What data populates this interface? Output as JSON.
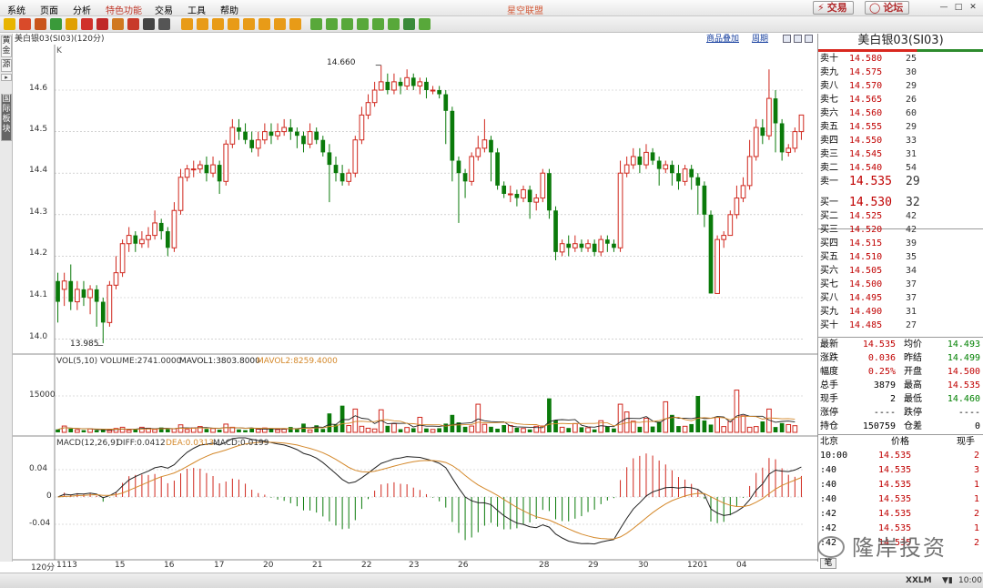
{
  "menu": [
    "系统",
    "页面",
    "分析",
    "特色功能",
    "交易",
    "工具",
    "帮助"
  ],
  "app_title": "星空联盟",
  "top_buttons": {
    "trade": "交易",
    "forum": "论坛"
  },
  "toolbar_icons": [
    "back-icon",
    "home-icon",
    "screen-icon",
    "refresh-icon",
    "zoom-in-icon",
    "zoom-out-icon",
    "pen-icon",
    "cursor-icon",
    "filter-icon",
    "grid-icon",
    "kline-icon",
    "period-1m",
    "period-5m",
    "period-15m",
    "period-30m",
    "period-60m",
    "period-day",
    "period-week",
    "period-month",
    "period-1-icon",
    "period-3-icon",
    "period-15-icon",
    "period-30-icon",
    "period-60-icon",
    "period-120-icon",
    "period-tick-icon",
    "period-min-icon"
  ],
  "side_tabs": [
    "黄金",
    "源",
    "国际板块"
  ],
  "chart": {
    "title": "美白银03(SI03)(120分)",
    "links": [
      "商品叠加",
      "周期"
    ],
    "k_label": "K",
    "annotations": {
      "high": "14.660",
      "low": "13.985"
    },
    "y_ticks": [
      "14.6",
      "14.5",
      "14.4",
      "14.3",
      "14.2",
      "14.1",
      "14.0"
    ],
    "x_ticks": [
      "1113",
      "15",
      "16",
      "17",
      "20",
      "21",
      "22",
      "23",
      "26",
      "28",
      "29",
      "30",
      "1201",
      "04"
    ],
    "period_label": "120分",
    "volume": {
      "label_vol": "VOL(5,10)",
      "label_volume": "VOLUME:2741.0000",
      "label_mavol1": "MAVOL1:3803.8000",
      "label_mavol2": "MAVOL2:8259.4000",
      "y_tick": "15000"
    },
    "macd": {
      "label_macd": "MACD(12,26,9)",
      "label_diff": "DIFF:0.0412",
      "label_dea": "DEA:0.0313",
      "label_value": "MACD:0.0199",
      "y_ticks": [
        "0.04",
        "0",
        "-0.04"
      ]
    }
  },
  "colors": {
    "up": "#d0271d",
    "down": "#0a7a0a",
    "ma1": "#222222",
    "ma2": "#d4882a"
  },
  "chart_data": [
    {
      "type": "candlestick",
      "title": "美白银03(SI03)(120分)",
      "ylim": [
        13.96,
        14.71
      ],
      "y_ticks": [
        14.0,
        14.1,
        14.2,
        14.3,
        14.4,
        14.5,
        14.6
      ],
      "x_ticks": [
        "1113",
        "15",
        "16",
        "17",
        "20",
        "21",
        "22",
        "23",
        "26",
        "28",
        "29",
        "30",
        "1201",
        "04"
      ],
      "high": 14.66,
      "low": 13.985,
      "candles": [
        [
          14.14,
          14.09,
          14.16,
          14.04
        ],
        [
          14.12,
          14.14,
          14.16,
          14.08
        ],
        [
          14.14,
          14.09,
          14.18,
          14.07
        ],
        [
          14.09,
          14.12,
          14.14,
          14.07
        ],
        [
          14.12,
          14.1,
          14.14,
          14.08
        ],
        [
          14.1,
          14.12,
          14.13,
          14.06
        ],
        [
          14.12,
          14.09,
          14.13,
          14.03
        ],
        [
          14.09,
          14.04,
          14.1,
          13.99
        ],
        [
          14.04,
          14.13,
          14.14,
          14.03
        ],
        [
          14.13,
          14.16,
          14.2,
          14.12
        ],
        [
          14.16,
          14.23,
          14.24,
          14.15
        ],
        [
          14.23,
          14.25,
          14.27,
          14.21
        ],
        [
          14.25,
          14.23,
          14.26,
          14.21
        ],
        [
          14.23,
          14.24,
          14.26,
          14.22
        ],
        [
          14.24,
          14.25,
          14.27,
          14.22
        ],
        [
          14.25,
          14.28,
          14.31,
          14.24
        ],
        [
          14.28,
          14.26,
          14.29,
          14.24
        ],
        [
          14.26,
          14.22,
          14.27,
          14.2
        ],
        [
          14.22,
          14.31,
          14.33,
          14.21
        ],
        [
          14.31,
          14.39,
          14.41,
          14.3
        ],
        [
          14.39,
          14.41,
          14.42,
          14.38
        ],
        [
          14.41,
          14.41,
          14.43,
          14.39
        ],
        [
          14.41,
          14.42,
          14.43,
          14.4
        ],
        [
          14.42,
          14.4,
          14.44,
          14.38
        ],
        [
          14.4,
          14.42,
          14.44,
          14.39
        ],
        [
          14.42,
          14.38,
          14.43,
          14.35
        ],
        [
          14.38,
          14.47,
          14.48,
          14.37
        ],
        [
          14.47,
          14.51,
          14.53,
          14.46
        ],
        [
          14.51,
          14.5,
          14.53,
          14.48
        ],
        [
          14.5,
          14.48,
          14.52,
          14.47
        ],
        [
          14.48,
          14.46,
          14.5,
          14.45
        ],
        [
          14.46,
          14.48,
          14.5,
          14.44
        ],
        [
          14.48,
          14.5,
          14.52,
          14.47
        ],
        [
          14.5,
          14.49,
          14.52,
          14.47
        ],
        [
          14.49,
          14.5,
          14.52,
          14.48
        ],
        [
          14.5,
          14.51,
          14.53,
          14.49
        ],
        [
          14.51,
          14.5,
          14.53,
          14.48
        ],
        [
          14.5,
          14.49,
          14.51,
          14.46
        ],
        [
          14.49,
          14.47,
          14.5,
          14.45
        ],
        [
          14.47,
          14.5,
          14.52,
          14.46
        ],
        [
          14.5,
          14.48,
          14.51,
          14.47
        ],
        [
          14.48,
          14.45,
          14.49,
          14.44
        ],
        [
          14.45,
          14.42,
          14.47,
          14.33
        ],
        [
          14.42,
          14.4,
          14.44,
          14.38
        ],
        [
          14.4,
          14.38,
          14.42,
          14.37
        ],
        [
          14.38,
          14.4,
          14.41,
          14.37
        ],
        [
          14.4,
          14.48,
          14.49,
          14.39
        ],
        [
          14.48,
          14.54,
          14.56,
          14.47
        ],
        [
          14.54,
          14.57,
          14.59,
          14.53
        ],
        [
          14.57,
          14.6,
          14.62,
          14.56
        ],
        [
          14.6,
          14.62,
          14.66,
          14.6
        ],
        [
          14.62,
          14.6,
          14.64,
          14.59
        ],
        [
          14.6,
          14.62,
          14.64,
          14.59
        ],
        [
          14.62,
          14.61,
          14.63,
          14.59
        ],
        [
          14.61,
          14.63,
          14.65,
          14.6
        ],
        [
          14.63,
          14.61,
          14.64,
          14.6
        ],
        [
          14.61,
          14.62,
          14.63,
          14.59
        ],
        [
          14.62,
          14.6,
          14.63,
          14.58
        ],
        [
          14.6,
          14.6,
          14.61,
          14.59
        ],
        [
          14.6,
          14.59,
          14.61,
          14.58
        ],
        [
          14.59,
          14.55,
          14.6,
          14.47
        ],
        [
          14.55,
          14.43,
          14.56,
          14.38
        ],
        [
          14.43,
          14.4,
          14.44,
          14.28
        ],
        [
          14.4,
          14.38,
          14.41,
          14.34
        ],
        [
          14.38,
          14.44,
          14.45,
          14.37
        ],
        [
          14.44,
          14.46,
          14.49,
          14.43
        ],
        [
          14.46,
          14.48,
          14.53,
          14.45
        ],
        [
          14.48,
          14.45,
          14.49,
          14.38
        ],
        [
          14.45,
          14.37,
          14.46,
          14.36
        ],
        [
          14.37,
          14.35,
          14.38,
          14.34
        ],
        [
          14.35,
          14.35,
          14.37,
          14.33
        ],
        [
          14.35,
          14.34,
          14.36,
          14.32
        ],
        [
          14.34,
          14.36,
          14.37,
          14.33
        ],
        [
          14.36,
          14.33,
          14.37,
          14.29
        ],
        [
          14.33,
          14.34,
          14.35,
          14.31
        ],
        [
          14.34,
          14.4,
          14.41,
          14.33
        ],
        [
          14.4,
          14.31,
          14.41,
          14.29
        ],
        [
          14.31,
          14.21,
          14.32,
          14.19
        ],
        [
          14.21,
          14.23,
          14.24,
          14.2
        ],
        [
          14.23,
          14.22,
          14.25,
          14.2
        ],
        [
          14.22,
          14.23,
          14.25,
          14.21
        ],
        [
          14.23,
          14.22,
          14.24,
          14.21
        ],
        [
          14.22,
          14.23,
          14.24,
          14.21
        ],
        [
          14.23,
          14.21,
          14.24,
          14.2
        ],
        [
          14.21,
          14.24,
          14.25,
          14.2
        ],
        [
          14.24,
          14.23,
          14.25,
          14.21
        ],
        [
          14.23,
          14.22,
          14.24,
          14.21
        ],
        [
          14.22,
          14.4,
          14.43,
          14.21
        ],
        [
          14.4,
          14.42,
          14.44,
          14.39
        ],
        [
          14.42,
          14.44,
          14.46,
          14.41
        ],
        [
          14.44,
          14.42,
          14.46,
          14.4
        ],
        [
          14.42,
          14.45,
          14.47,
          14.41
        ],
        [
          14.45,
          14.43,
          14.46,
          14.42
        ],
        [
          14.43,
          14.41,
          14.44,
          14.37
        ],
        [
          14.41,
          14.42,
          14.43,
          14.4
        ],
        [
          14.42,
          14.4,
          14.43,
          14.37
        ],
        [
          14.4,
          14.38,
          14.42,
          14.36
        ],
        [
          14.38,
          14.41,
          14.42,
          14.37
        ],
        [
          14.41,
          14.39,
          14.42,
          14.36
        ],
        [
          14.39,
          14.37,
          14.4,
          14.3
        ],
        [
          14.37,
          14.3,
          14.38,
          14.27
        ],
        [
          14.3,
          14.11,
          14.31,
          14.11
        ],
        [
          14.11,
          14.24,
          14.25,
          14.11
        ],
        [
          14.24,
          14.25,
          14.26,
          14.22
        ],
        [
          14.25,
          14.3,
          14.31,
          14.27
        ],
        [
          14.3,
          14.34,
          14.37,
          14.29
        ],
        [
          14.34,
          14.37,
          14.39,
          14.33
        ],
        [
          14.37,
          14.44,
          14.48,
          14.36
        ],
        [
          14.44,
          14.51,
          14.53,
          14.43
        ],
        [
          14.51,
          14.49,
          14.53,
          14.47
        ],
        [
          14.49,
          14.58,
          14.65,
          14.48
        ],
        [
          14.58,
          14.52,
          14.6,
          14.45
        ],
        [
          14.52,
          14.45,
          14.53,
          14.43
        ],
        [
          14.45,
          14.46,
          14.47,
          14.44
        ],
        [
          14.46,
          14.5,
          14.51,
          14.45
        ],
        [
          14.5,
          14.54,
          14.54,
          14.48
        ]
      ]
    },
    {
      "type": "bar",
      "title": "VOL(5,10)",
      "y_ticks": [
        15000
      ],
      "ylim": [
        0,
        25000
      ],
      "values": [
        1200,
        2600,
        1500,
        1100,
        900,
        1400,
        900,
        1300,
        800,
        1600,
        2100,
        900,
        1400,
        2100,
        1700,
        1200,
        2000,
        1300,
        1500,
        3100,
        1200,
        1800,
        2400,
        1400,
        1600,
        1100,
        3400,
        2100,
        1200,
        900,
        1600,
        1300,
        1800,
        1500,
        1100,
        1300,
        2200,
        1500,
        3600,
        1000,
        2900,
        1400,
        7800,
        3200,
        11000,
        2800,
        9600,
        2500,
        1700,
        1400,
        9300,
        2700,
        3600,
        1300,
        2000,
        1700,
        6200,
        1600,
        1200,
        1700,
        3600,
        7200,
        4100,
        2300,
        2600,
        11600,
        3300,
        2300,
        1500,
        3000,
        2800,
        1900,
        1600,
        1200,
        2500,
        2600,
        14000,
        5000,
        2100,
        1800,
        3600,
        2100,
        1900,
        1200,
        4800,
        2400,
        1600,
        11600,
        8400,
        4600,
        2300,
        5800,
        2400,
        4400,
        12600,
        7200,
        2600,
        2500,
        3400,
        15000,
        4900,
        3200,
        6200,
        2400,
        4500,
        17400,
        6800,
        2100,
        2400,
        4500,
        9600,
        2200,
        3800,
        3200,
        2741
      ],
      "mavol1": 3803.8,
      "mavol2": 8259.4
    },
    {
      "type": "bar",
      "title": "MACD(12,26,9)",
      "y_ticks": [
        0.04,
        0,
        -0.04
      ],
      "ylim": [
        -0.07,
        0.075
      ],
      "diff": 0.0412,
      "dea": 0.0313,
      "macd": 0.0199
    }
  ],
  "panel": {
    "title": "美白银03(SI03)",
    "asks": [
      {
        "label": "卖十",
        "price": "14.580",
        "vol": "25"
      },
      {
        "label": "卖九",
        "price": "14.575",
        "vol": "30"
      },
      {
        "label": "卖八",
        "price": "14.570",
        "vol": "29"
      },
      {
        "label": "卖七",
        "price": "14.565",
        "vol": "26"
      },
      {
        "label": "卖六",
        "price": "14.560",
        "vol": "60"
      },
      {
        "label": "卖五",
        "price": "14.555",
        "vol": "29"
      },
      {
        "label": "卖四",
        "price": "14.550",
        "vol": "33"
      },
      {
        "label": "卖三",
        "price": "14.545",
        "vol": "31"
      },
      {
        "label": "卖二",
        "price": "14.540",
        "vol": "54"
      },
      {
        "label": "卖一",
        "price": "14.535",
        "vol": "29"
      }
    ],
    "bids": [
      {
        "label": "买一",
        "price": "14.530",
        "vol": "32"
      },
      {
        "label": "买二",
        "price": "14.525",
        "vol": "42"
      },
      {
        "label": "买三",
        "price": "14.520",
        "vol": "42"
      },
      {
        "label": "买四",
        "price": "14.515",
        "vol": "39"
      },
      {
        "label": "买五",
        "price": "14.510",
        "vol": "35"
      },
      {
        "label": "买六",
        "price": "14.505",
        "vol": "34"
      },
      {
        "label": "买七",
        "price": "14.500",
        "vol": "37"
      },
      {
        "label": "买八",
        "price": "14.495",
        "vol": "37"
      },
      {
        "label": "买九",
        "price": "14.490",
        "vol": "31"
      },
      {
        "label": "买十",
        "price": "14.485",
        "vol": "27"
      }
    ],
    "stats": [
      {
        "k1": "最新",
        "v1": "14.535",
        "k2": "均价",
        "v2": "14.493"
      },
      {
        "k1": "涨跌",
        "v1": "0.036",
        "k2": "昨结",
        "v2": "14.499"
      },
      {
        "k1": "幅度",
        "v1": "0.25%",
        "k2": "开盘",
        "v2": "14.500"
      },
      {
        "k1": "总手",
        "v1": "3879",
        "k2": "最高",
        "v2": "14.535"
      },
      {
        "k1": "现手",
        "v1": "2",
        "k2": "最低",
        "v2": "14.460"
      },
      {
        "k1": "涨停",
        "v1": "----",
        "k2": "跌停",
        "v2": "----"
      },
      {
        "k1": "持仓",
        "v1": "150759",
        "k2": "仓差",
        "v2": "0"
      }
    ],
    "ticks_header": {
      "time": "北京",
      "price": "价格",
      "vol": "现手"
    },
    "ticks": [
      {
        "t": "10:00",
        "p": "14.535",
        "v": "2"
      },
      {
        "t": ":40",
        "p": "14.535",
        "v": "3"
      },
      {
        "t": ":40",
        "p": "14.535",
        "v": "1"
      },
      {
        "t": ":40",
        "p": "14.535",
        "v": "1"
      },
      {
        "t": ":42",
        "p": "14.535",
        "v": "2"
      },
      {
        "t": ":42",
        "p": "14.535",
        "v": "1"
      },
      {
        "t": ":42",
        "p": "14.535",
        "v": "2"
      }
    ],
    "pen_tab": "笔"
  },
  "watermark": "隆岸投资",
  "status": {
    "brand": "XXLM",
    "clock": "10:00"
  }
}
